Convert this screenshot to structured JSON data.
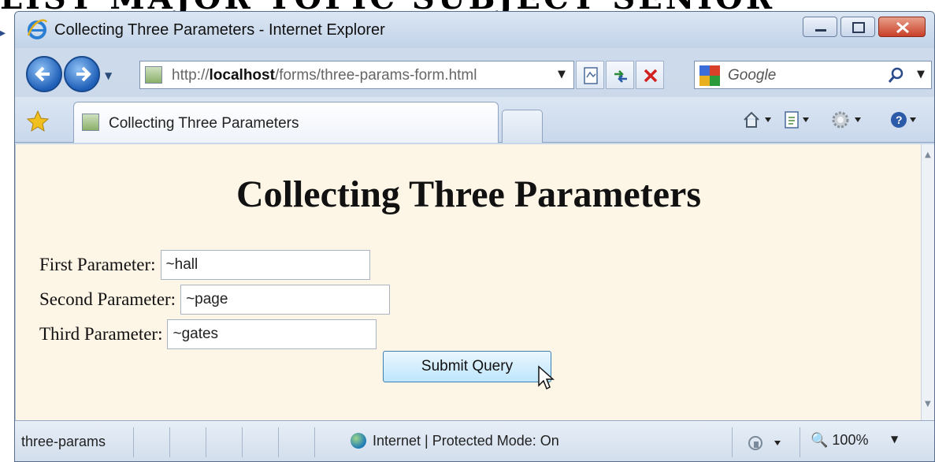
{
  "browser": {
    "window_title": "Collecting Three Parameters - Internet Explorer",
    "address_url_prefix": "http://",
    "address_url_host": "localhost",
    "address_url_path": "/forms/three-params-form.html",
    "search_placeholder": "Google",
    "tab_label": "Collecting Three Parameters"
  },
  "page": {
    "heading": "Collecting Three Parameters",
    "fields": [
      {
        "label": "First Parameter:",
        "value": "~hall"
      },
      {
        "label": "Second Parameter:",
        "value": "~page"
      },
      {
        "label": "Third Parameter:",
        "value": "~gates"
      }
    ],
    "submit_label": "Submit Query"
  },
  "status_bar": {
    "text": "three-params",
    "zone": "Internet | Protected Mode: On",
    "zoom": "100%"
  },
  "icons": {
    "browser_logo": "internet-explorer-icon",
    "back": "back-arrow-icon",
    "forward": "forward-arrow-icon",
    "refresh": "refresh-icon",
    "stop": "stop-icon",
    "search": "search-icon",
    "favorites": "star-icon",
    "home": "home-icon",
    "page": "page-icon",
    "tools": "gear-icon",
    "help": "help-icon"
  },
  "colors": {
    "page_background": "#fdf5e6",
    "chrome": "#c2d3e8",
    "close_button": "#c9402a"
  }
}
